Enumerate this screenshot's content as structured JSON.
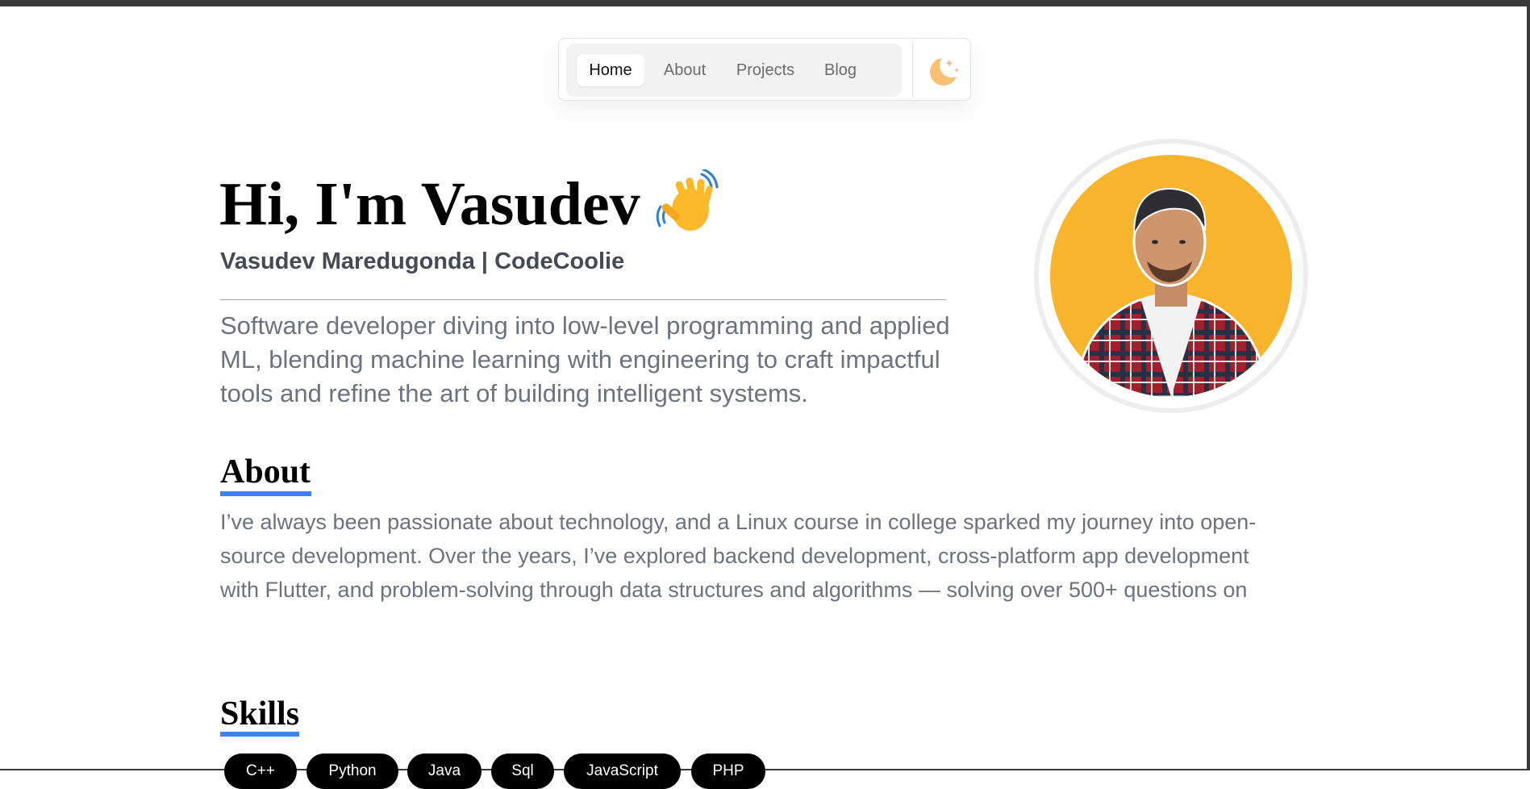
{
  "nav": {
    "items": [
      {
        "label": "Home",
        "active": true
      },
      {
        "label": "About",
        "active": false
      },
      {
        "label": "Projects",
        "active": false
      },
      {
        "label": "Blog",
        "active": false
      }
    ],
    "theme_toggle_icon": "moon-stars-icon"
  },
  "hero": {
    "title": "Hi, I'm Vasudev",
    "wave_icon": "waving-hand-icon",
    "subtitle": "Vasudev Maredugonda | CodeCoolie",
    "bio": "Software developer diving into low-level programming and applied ML, blending machine learning with engineering to craft impactful tools and refine the art of building intelligent systems."
  },
  "avatar": {
    "icon": "profile-photo",
    "background_color": "#f7b42c"
  },
  "about": {
    "heading": "About",
    "text": "I’ve always been passionate about technology, and a Linux course in college sparked my journey into open-source development. Over the years, I’ve explored backend development, cross-platform app development with Flutter, and problem-solving through data structures and algorithms — solving over 500+ questions on"
  },
  "skills": {
    "heading": "Skills",
    "items": [
      "C++",
      "Python",
      "Java",
      "Sql",
      "JavaScript",
      "PHP"
    ]
  },
  "colors": {
    "accent": "#3b82f6",
    "text_muted": "#6b7280",
    "subtitle": "#454b54"
  }
}
